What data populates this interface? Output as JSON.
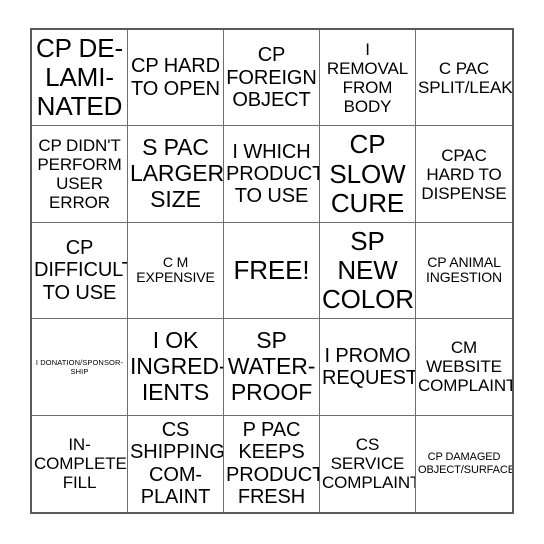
{
  "card": {
    "name": "bingo-card",
    "free_space_label": "FREE!",
    "grid": {
      "columns": 5,
      "rows": 5
    },
    "cells": [
      {
        "id": "r1c1",
        "text": "CP DE-\nLAMI-\nNATED",
        "size": "xxl"
      },
      {
        "id": "r1c2",
        "text": "CP HARD\nTO OPEN",
        "size": "lg"
      },
      {
        "id": "r1c3",
        "text": "CP\nFOREIGN\nOBJECT",
        "size": "lg"
      },
      {
        "id": "r1c4",
        "text": "I\nREMOVAL\nFROM\nBODY",
        "size": "md"
      },
      {
        "id": "r1c5",
        "text": "C PAC\nSPLIT/LEAK",
        "size": "md"
      },
      {
        "id": "r2c1",
        "text": "CP DIDN'T\nPERFORM\nUSER\nERROR",
        "size": "md"
      },
      {
        "id": "r2c2",
        "text": "S PAC\nLARGER\nSIZE",
        "size": "xl"
      },
      {
        "id": "r2c3",
        "text": "I WHICH\nPRODUCT\nTO USE",
        "size": "lg"
      },
      {
        "id": "r2c4",
        "text": "CP\nSLOW\nCURE",
        "size": "xxl"
      },
      {
        "id": "r2c5",
        "text": "CPAC\nHARD TO\nDISPENSE",
        "size": "md"
      },
      {
        "id": "r3c1",
        "text": "CP\nDIFFICULT\nTO USE",
        "size": "lg"
      },
      {
        "id": "r3c2",
        "text": "C M\nEXPENSIVE",
        "size": "sm"
      },
      {
        "id": "r3c3",
        "text": "FREE!",
        "size": "xxl"
      },
      {
        "id": "r3c4",
        "text": "SP\nNEW\nCOLOR",
        "size": "xxl"
      },
      {
        "id": "r3c5",
        "text": "CP ANIMAL\nINGESTION",
        "size": "sm"
      },
      {
        "id": "r4c1",
        "text": "I DONATION/SPONSOR-\nSHIP",
        "size": "xxs"
      },
      {
        "id": "r4c2",
        "text": "I OK\nINGRED-\nIENTS",
        "size": "xl"
      },
      {
        "id": "r4c3",
        "text": "SP\nWATER-\nPROOF",
        "size": "xl"
      },
      {
        "id": "r4c4",
        "text": "I PROMO\nREQUEST",
        "size": "lg"
      },
      {
        "id": "r4c5",
        "text": "CM\nWEBSITE\nCOMPLAINT",
        "size": "md"
      },
      {
        "id": "r5c1",
        "text": "IN-\nCOMPLETE\nFILL",
        "size": "md"
      },
      {
        "id": "r5c2",
        "text": "CS\nSHIPPING\nCOM-\nPLAINT",
        "size": "lg"
      },
      {
        "id": "r5c3",
        "text": "P PAC\nKEEPS\nPRODUCT\nFRESH",
        "size": "lg"
      },
      {
        "id": "r5c4",
        "text": "CS\nSERVICE\nCOMPLAINT",
        "size": "md"
      },
      {
        "id": "r5c5",
        "text": "CP DAMAGED\nOBJECT/SURFACE",
        "size": "xs"
      }
    ]
  },
  "colors": {
    "border_outer": "#5a5a5a",
    "border_inner": "#6e6e6e",
    "background": "#ffffff",
    "text": "#000000"
  }
}
